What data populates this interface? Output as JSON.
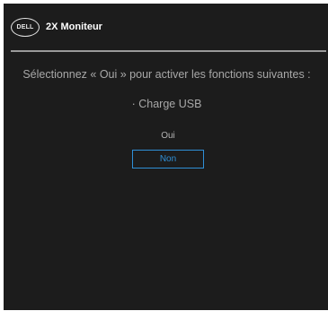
{
  "header": {
    "logo_text": "DELL",
    "title": "2X Moniteur"
  },
  "dialog": {
    "prompt": "Sélectionnez « Oui » pour activer les fonctions suivantes :",
    "feature": "· Charge USB",
    "options": [
      {
        "label": "Oui",
        "selected": false
      },
      {
        "label": "Non",
        "selected": true
      }
    ]
  },
  "colors": {
    "background": "#1c1c1c",
    "text": "#a8a8a8",
    "accent": "#2f8fd6",
    "divider": "#9a9a9a"
  }
}
